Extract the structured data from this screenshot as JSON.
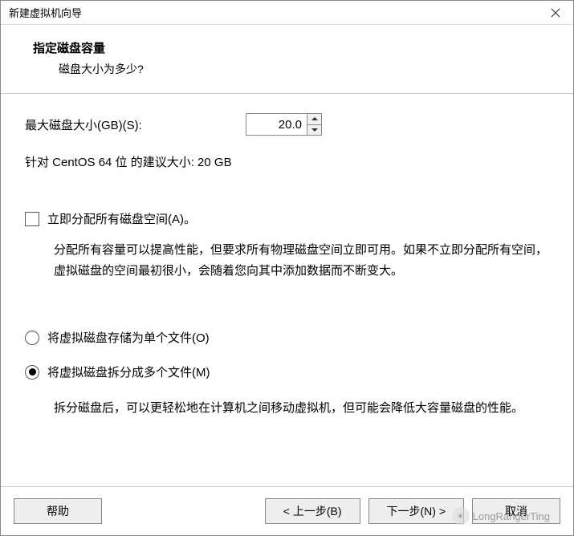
{
  "titlebar": {
    "title": "新建虚拟机向导"
  },
  "header": {
    "title": "指定磁盘容量",
    "subtitle": "磁盘大小为多少?"
  },
  "disk_size": {
    "label": "最大磁盘大小(GB)(S):",
    "value": "20.0",
    "recommend_text": "针对 CentOS 64 位 的建议大小: 20 GB"
  },
  "allocate_now": {
    "label": "立即分配所有磁盘空间(A)。",
    "checked": false,
    "desc": "分配所有容量可以提高性能，但要求所有物理磁盘空间立即可用。如果不立即分配所有空间，虚拟磁盘的空间最初很小，会随着您向其中添加数据而不断变大。"
  },
  "storage_mode": {
    "single": {
      "label": "将虚拟磁盘存储为单个文件(O)",
      "selected": false
    },
    "split": {
      "label": "将虚拟磁盘拆分成多个文件(M)",
      "selected": true,
      "desc": "拆分磁盘后，可以更轻松地在计算机之间移动虚拟机，但可能会降低大容量磁盘的性能。"
    }
  },
  "footer": {
    "help": "帮助",
    "back": "< 上一步(B)",
    "next": "下一步(N) >",
    "cancel": "取消"
  },
  "watermark": {
    "text": "LongRangerTing"
  }
}
